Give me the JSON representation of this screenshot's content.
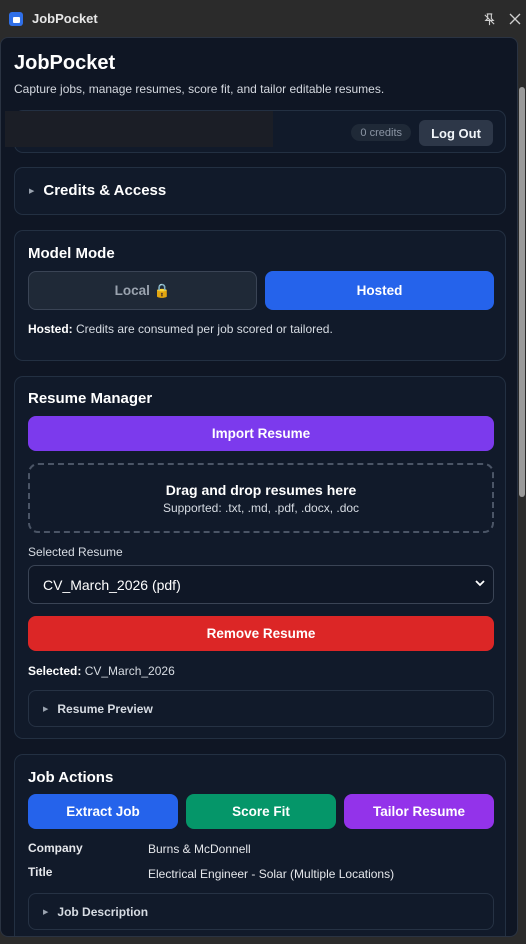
{
  "window": {
    "title": "JobPocket"
  },
  "header": {
    "title": "JobPocket",
    "subtitle": "Capture jobs, manage resumes, score fit, and tailor editable resumes."
  },
  "account": {
    "credits": "0 credits",
    "logout_label": "Log Out"
  },
  "credits_access": {
    "label": "Credits & Access"
  },
  "model_mode": {
    "heading": "Model Mode",
    "local_label": "Local 🔒",
    "hosted_label": "Hosted",
    "note_strong": "Hosted:",
    "note_text": " Credits are consumed per job scored or tailored."
  },
  "resume_manager": {
    "heading": "Resume Manager",
    "import_label": "Import Resume",
    "dropzone_title": "Drag and drop resumes here",
    "dropzone_sub": "Supported: .txt, .md, .pdf, .docx, .doc",
    "select_label": "Selected Resume",
    "selected_option": "CV_March_2026 (pdf)",
    "remove_label": "Remove Resume",
    "selected_strong": "Selected:",
    "selected_value": " CV_March_2026",
    "preview_label": "Resume Preview"
  },
  "job_actions": {
    "heading": "Job Actions",
    "extract_label": "Extract Job",
    "score_label": "Score Fit",
    "tailor_label": "Tailor Resume",
    "company_key": "Company",
    "company_value": "Burns & McDonnell",
    "title_key": "Title",
    "title_value": "Electrical Engineer - Solar (Multiple Locations)",
    "description_label": "Job Description"
  },
  "colors": {
    "accent_blue": "#2563eb",
    "purple": "#7c3aed",
    "green": "#059669",
    "red": "#dc2626",
    "magenta": "#9333ea"
  }
}
